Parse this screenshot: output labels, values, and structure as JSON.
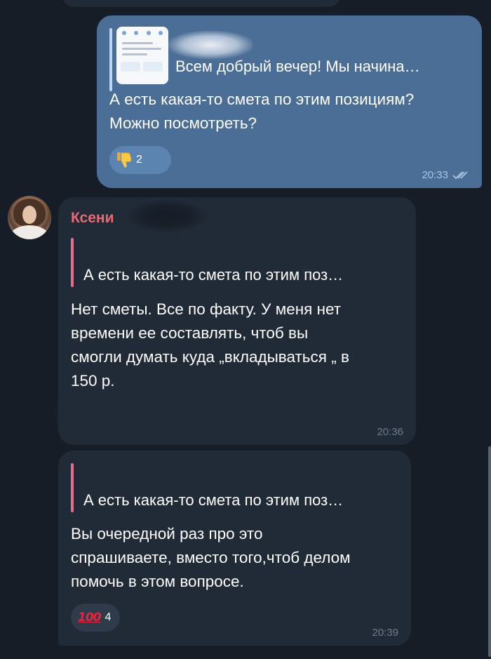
{
  "colors": {
    "background": "#161d27",
    "outgoing_bubble": "#4b6e97",
    "incoming_bubble": "#212a37",
    "sender_name": "#e86a72",
    "reply_bar_in": "#e26f8e",
    "reply_bar_out": "#bcd6f2",
    "time_out": "#a9c4e3",
    "time_in": "#6d7c8f"
  },
  "messages": [
    {
      "direction": "outgoing",
      "reply_preview": "Всем добрый вечер! Мы начина…",
      "reply_has_thumbnail": true,
      "text": "А есть какая-то смета по этим позициям?\nМожно посмотреть?",
      "reaction": {
        "icon": "thumbs-down-icon",
        "count": "2"
      },
      "time": "20:33",
      "status_icon": "double-check-icon"
    },
    {
      "direction": "incoming",
      "sender": "Ксени",
      "reply_preview": "А есть какая-то смета по этим поз…",
      "text": "Нет сметы. Все по факту. У меня нет\nвремени ее составлять, чтоб вы\nсмогли думать куда „вкладываться „ в\n150 р.",
      "time": "20:36"
    },
    {
      "direction": "incoming",
      "reply_preview": "А есть какая-то смета по этим поз…",
      "text": "Вы очередной раз про это\nспрашиваете, вместо того,чтоб делом\nпомочь в этом вопросе.",
      "reaction": {
        "icon": "hundred-points-icon",
        "label": "100",
        "count": "4"
      },
      "time": "20:39"
    }
  ]
}
